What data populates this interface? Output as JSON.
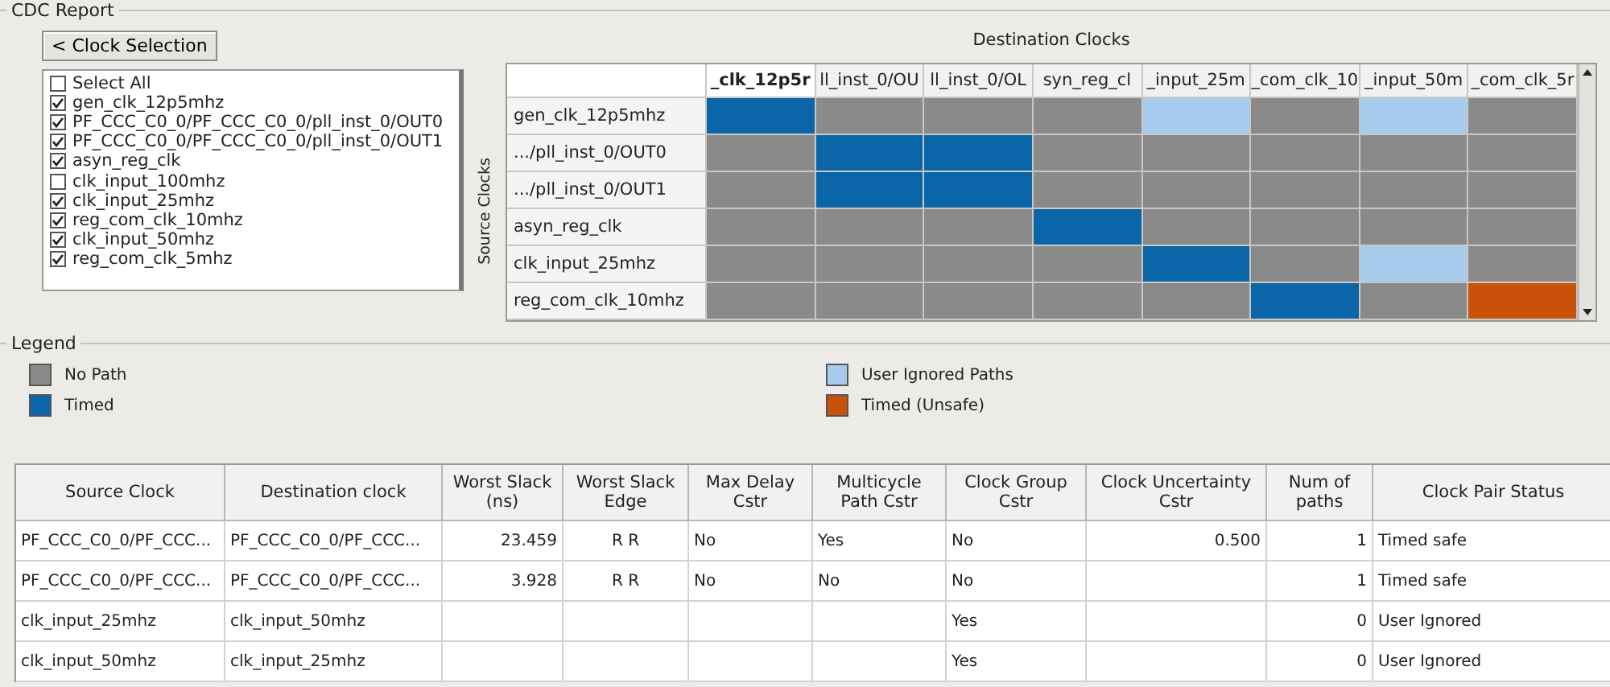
{
  "report": {
    "title": "CDC Report",
    "back_button": "< Clock Selection",
    "destination_label": "Destination Clocks",
    "source_label": "Source Clocks",
    "clock_list": [
      {
        "label": "Select All",
        "checked": false
      },
      {
        "label": "gen_clk_12p5mhz",
        "checked": true
      },
      {
        "label": "PF_CCC_C0_0/PF_CCC_C0_0/pll_inst_0/OUT0",
        "checked": true
      },
      {
        "label": "PF_CCC_C0_0/PF_CCC_C0_0/pll_inst_0/OUT1",
        "checked": true
      },
      {
        "label": "asyn_reg_clk",
        "checked": true
      },
      {
        "label": "clk_input_100mhz",
        "checked": false
      },
      {
        "label": "clk_input_25mhz",
        "checked": true
      },
      {
        "label": "reg_com_clk_10mhz",
        "checked": true
      },
      {
        "label": "clk_input_50mhz",
        "checked": true
      },
      {
        "label": "reg_com_clk_5mhz",
        "checked": true
      }
    ],
    "matrix": {
      "columns": [
        {
          "label": "_clk_12p5r",
          "selected": true
        },
        {
          "label": "ll_inst_0/OU",
          "selected": false
        },
        {
          "label": "ll_inst_0/OL",
          "selected": false
        },
        {
          "label": "syn_reg_cl",
          "selected": false
        },
        {
          "label": "_input_25m",
          "selected": false
        },
        {
          "label": "_com_clk_10",
          "selected": false
        },
        {
          "label": "_input_50m",
          "selected": false
        },
        {
          "label": "_com_clk_5r",
          "selected": false
        }
      ],
      "rows": [
        {
          "label": "gen_clk_12p5mhz",
          "cells": [
            {
              "kind": "timed"
            },
            {
              "kind": "none"
            },
            {
              "kind": "none"
            },
            {
              "kind": "none"
            },
            {
              "kind": "ignored"
            },
            {
              "kind": "none"
            },
            {
              "kind": "ignored"
            },
            {
              "kind": "none"
            }
          ]
        },
        {
          "label": ".../pll_inst_0/OUT0",
          "cells": [
            {
              "kind": "none"
            },
            {
              "kind": "timed"
            },
            {
              "kind": "timed"
            },
            {
              "kind": "none"
            },
            {
              "kind": "none"
            },
            {
              "kind": "none"
            },
            {
              "kind": "none"
            },
            {
              "kind": "none"
            }
          ]
        },
        {
          "label": ".../pll_inst_0/OUT1",
          "cells": [
            {
              "kind": "none"
            },
            {
              "kind": "timed"
            },
            {
              "kind": "timed"
            },
            {
              "kind": "none"
            },
            {
              "kind": "none"
            },
            {
              "kind": "none"
            },
            {
              "kind": "none"
            },
            {
              "kind": "none"
            }
          ]
        },
        {
          "label": "asyn_reg_clk",
          "cells": [
            {
              "kind": "none"
            },
            {
              "kind": "none"
            },
            {
              "kind": "none"
            },
            {
              "kind": "timed"
            },
            {
              "kind": "none"
            },
            {
              "kind": "none"
            },
            {
              "kind": "none"
            },
            {
              "kind": "none"
            }
          ]
        },
        {
          "label": "clk_input_25mhz",
          "cells": [
            {
              "kind": "none"
            },
            {
              "kind": "none"
            },
            {
              "kind": "none"
            },
            {
              "kind": "none"
            },
            {
              "kind": "timed"
            },
            {
              "kind": "none"
            },
            {
              "kind": "ignored"
            },
            {
              "kind": "none"
            }
          ]
        },
        {
          "label": "reg_com_clk_10mhz",
          "cells": [
            {
              "kind": "none"
            },
            {
              "kind": "none"
            },
            {
              "kind": "none"
            },
            {
              "kind": "none"
            },
            {
              "kind": "none"
            },
            {
              "kind": "timed"
            },
            {
              "kind": "none"
            },
            {
              "kind": "unsafe"
            }
          ]
        }
      ]
    }
  },
  "legend": {
    "title": "Legend",
    "items": [
      {
        "kind": "none",
        "label": "No Path"
      },
      {
        "kind": "ignored",
        "label": "User Ignored Paths"
      },
      {
        "kind": "timed",
        "label": "Timed"
      },
      {
        "kind": "unsafe",
        "label": "Timed (Unsafe)"
      }
    ]
  },
  "table": {
    "columns": [
      "Source Clock",
      "Destination clock",
      "Worst Slack (ns)",
      "Worst Slack Edge",
      "Max Delay Cstr",
      "Multicycle Path Cstr",
      "Clock Group Cstr",
      "Clock Uncertainty Cstr",
      "Num of paths",
      "Clock Pair Status"
    ],
    "rows": [
      [
        "PF_CCC_C0_0/PF_CCC...",
        "PF_CCC_C0_0/PF_CCC...",
        "23.459",
        "R R",
        "No",
        "Yes",
        "No",
        "0.500",
        "1",
        "Timed safe"
      ],
      [
        "PF_CCC_C0_0/PF_CCC...",
        "PF_CCC_C0_0/PF_CCC...",
        "3.928",
        "R R",
        "No",
        "No",
        "No",
        "",
        "1",
        "Timed safe"
      ],
      [
        "clk_input_25mhz",
        "clk_input_50mhz",
        "",
        "",
        "",
        "",
        "Yes",
        "",
        "0",
        "User Ignored"
      ],
      [
        "clk_input_50mhz",
        "clk_input_25mhz",
        "",
        "",
        "",
        "",
        "Yes",
        "",
        "0",
        "User Ignored"
      ]
    ]
  }
}
